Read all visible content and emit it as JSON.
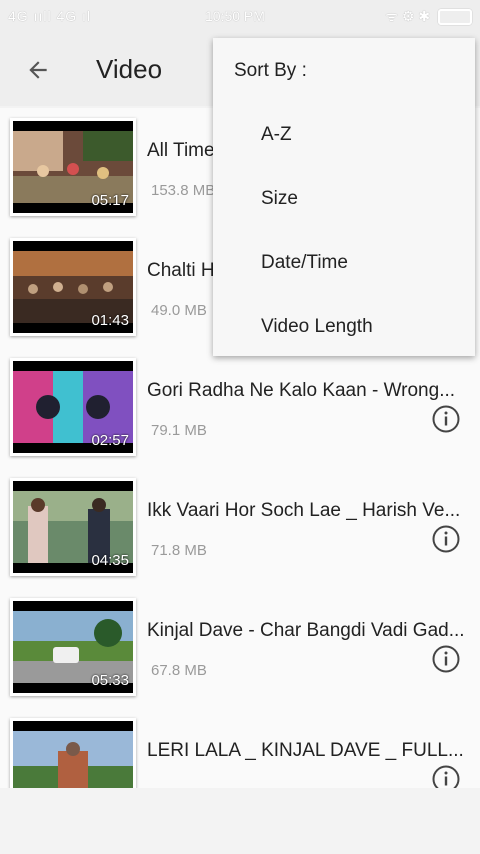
{
  "status_bar": {
    "network": "4G ııll 4G ıl",
    "time": "10:50 PM",
    "icons": "ᯤ ⚙ ✱"
  },
  "app_bar": {
    "title": "Video",
    "back_icon": "arrow-left-icon"
  },
  "videos": [
    {
      "title": "All Time",
      "size": "153.8 MB",
      "duration": "05:17"
    },
    {
      "title": "Chalti H",
      "size": "49.0 MB",
      "duration": "01:43"
    },
    {
      "title": "Gori Radha Ne Kalo Kaan - Wrong...",
      "size": "79.1 MB",
      "duration": "02:57"
    },
    {
      "title": "Ikk Vaari Hor Soch Lae _ Harish Ve...",
      "size": "71.8 MB",
      "duration": "04:35"
    },
    {
      "title": "Kinjal Dave - Char Bangdi Vadi Gad...",
      "size": "67.8 MB",
      "duration": "05:33"
    },
    {
      "title": "LERI LALA _ KINJAL DAVE _ FULL...",
      "size": "",
      "duration": ""
    }
  ],
  "sort_menu": {
    "header": "Sort By :",
    "options": [
      "A-Z",
      "Size",
      "Date/Time",
      "Video Length"
    ]
  },
  "colors": {
    "app_bar_bg": "#eeeeee",
    "list_bg": "#fafafa",
    "text_primary": "#222222",
    "text_secondary": "#9a9a9a"
  }
}
